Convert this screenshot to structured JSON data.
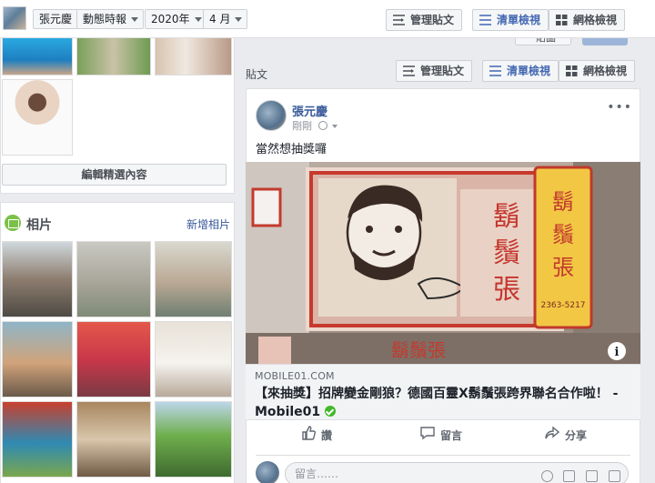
{
  "topbar": {
    "profile_name": "張元慶",
    "filter_label": "動態時報",
    "year_label": "2020年",
    "month_label": "4 月",
    "manage_posts_label": "管理貼文",
    "list_view_label": "清單檢視",
    "grid_view_label": "網格檢視"
  },
  "left": {
    "edit_featured_label": "編輯精選內容",
    "photos_title": "相片",
    "add_photos_label": "新增相片"
  },
  "right": {
    "partial_button_label": "貼圖",
    "section_label": "貼文",
    "manage_posts_label": "管理貼文",
    "list_view_label": "清單檢視",
    "grid_view_label": "網格檢視"
  },
  "post": {
    "author": "張元慶",
    "time": "剛剛",
    "message": "當然想抽獎囉",
    "link_domain": "MOBILE01.COM",
    "link_title": "【來抽獎】招牌變金剛狼？德國百靈X鬍鬚張跨界聯名合作啦！ - Mobile01",
    "like_label": "讚",
    "comment_label": "留言",
    "share_label": "分享",
    "comment_placeholder": "留言……"
  },
  "image_signage": {
    "main_sign": "鬍鬚張",
    "lower_sign": "鬍鬚張",
    "side_phone": "2363-5217"
  },
  "colors": {
    "link_blue": "#365899",
    "active_blue": "#4267b2",
    "photos_green": "#7bc148",
    "verified_green": "#42b72a",
    "page_bg": "#e9ebee"
  }
}
